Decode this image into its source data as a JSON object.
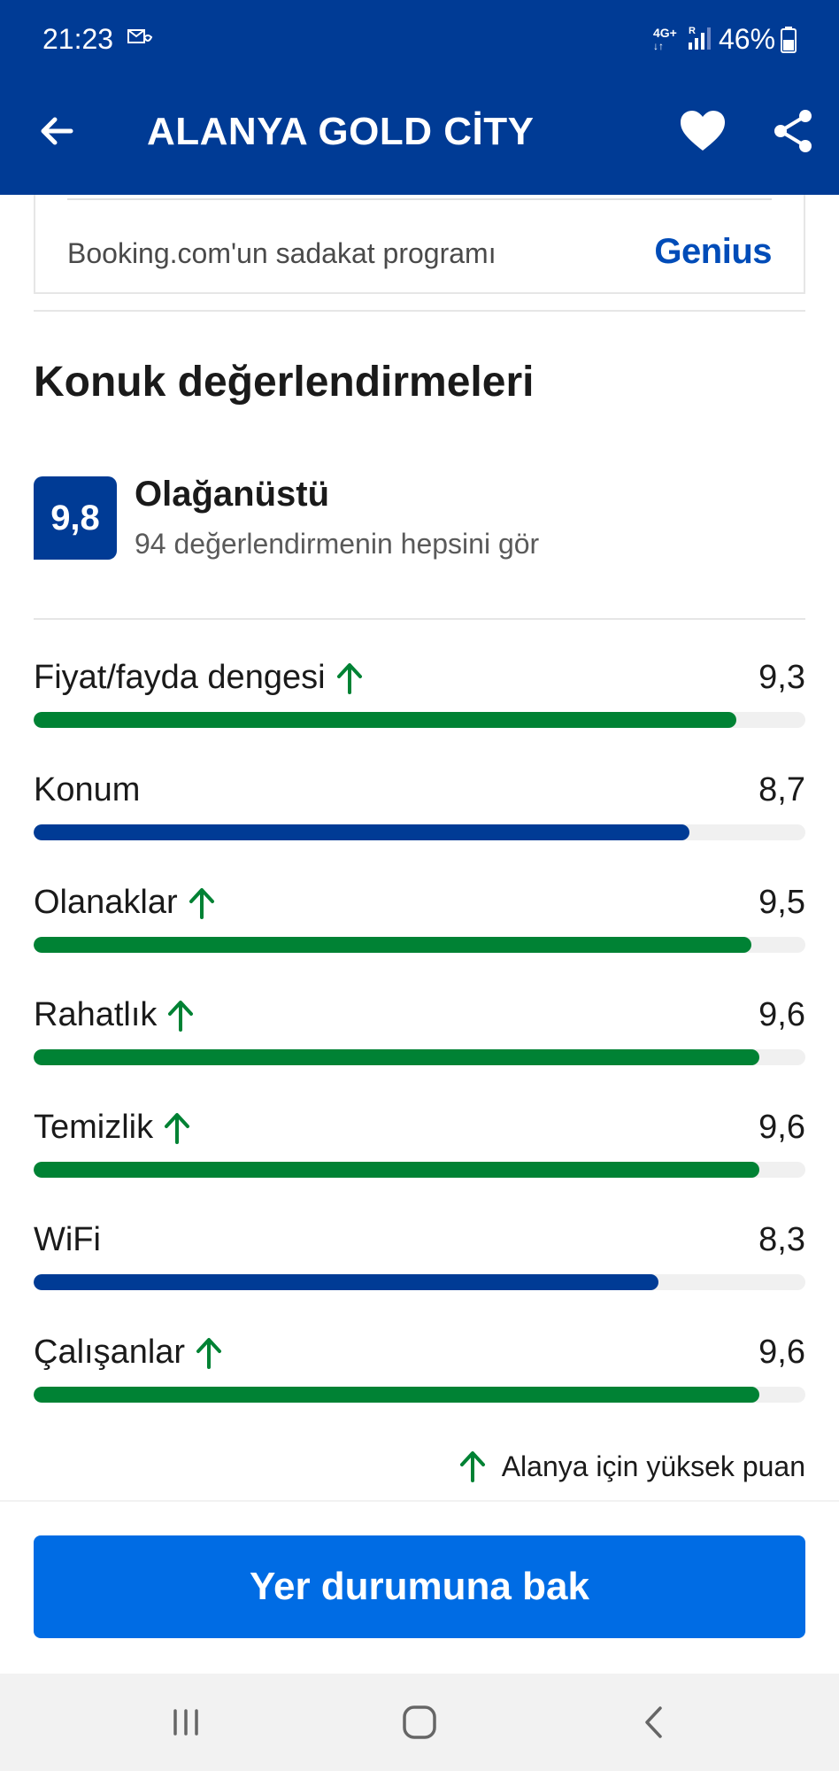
{
  "status_bar": {
    "time": "21:23",
    "network": "4G+",
    "roaming": "R",
    "battery": "46%"
  },
  "header": {
    "title": "ALANYA GOLD CİTY",
    "back_icon": "arrow-left-icon",
    "favorite_icon": "heart-icon",
    "share_icon": "share-icon"
  },
  "genius_card": {
    "label": "Booking.com'un sadakat programı",
    "brand": "Genius"
  },
  "reviews": {
    "title": "Konuk değerlendirmeleri",
    "score": "9,8",
    "score_word": "Olağanüstü",
    "all_reviews_link": "94 değerlendirmenin hepsini gör",
    "categories": [
      {
        "name": "Fiyat/fayda dengesi",
        "value": "9,3",
        "score": 9.3,
        "high": true
      },
      {
        "name": "Konum",
        "value": "8,7",
        "score": 8.7,
        "high": false
      },
      {
        "name": "Olanaklar",
        "value": "9,5",
        "score": 9.5,
        "high": true
      },
      {
        "name": "Rahatlık",
        "value": "9,6",
        "score": 9.6,
        "high": true
      },
      {
        "name": "Temizlik",
        "value": "9,6",
        "score": 9.6,
        "high": true
      },
      {
        "name": "WiFi",
        "value": "8,3",
        "score": 8.3,
        "high": false
      },
      {
        "name": "Çalışanlar",
        "value": "9,6",
        "score": 9.6,
        "high": true
      }
    ],
    "legend": "Alanya için yüksek puan",
    "max_score": 10
  },
  "cta": {
    "label": "Yer durumuna bak"
  },
  "colors": {
    "brand_dark": "#003b95",
    "cta_blue": "#006ce4",
    "high_green": "#008234",
    "track": "#f0f0f0"
  }
}
